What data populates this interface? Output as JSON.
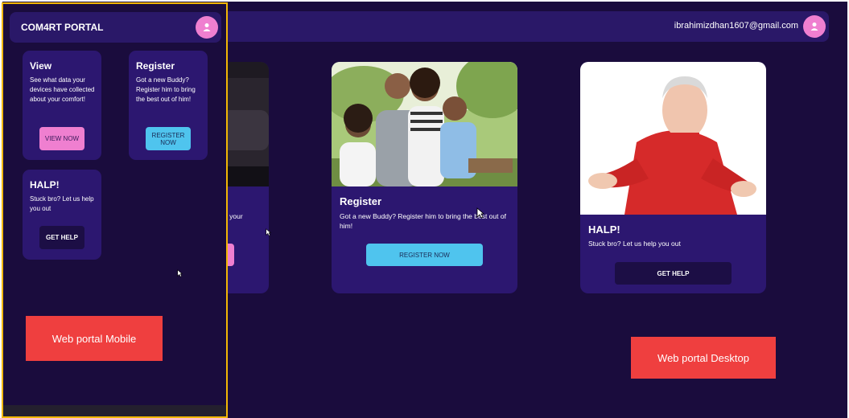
{
  "desktop": {
    "header": {
      "email": "ibrahimizdhan1607@gmail.com"
    },
    "cards": {
      "view": {
        "text": "out your",
        "button": ""
      },
      "register": {
        "title": "Register",
        "text": "Got a new Buddy? Register him to bring the best out of him!",
        "button": "REGISTER NOW"
      },
      "halp": {
        "title": "HALP!",
        "text": "Stuck bro? Let us help you out",
        "button": "GET HELP"
      }
    },
    "label": "Web portal Desktop"
  },
  "mobile": {
    "header": {
      "title": "COM4RT PORTAL"
    },
    "cards": {
      "view": {
        "title": "View",
        "text": "See what data your devices have collected about your comfort!",
        "button": "VIEW NOW"
      },
      "register": {
        "title": "Register",
        "text": "Got a new Buddy? Register him to bring the best out of him!",
        "button": "REGISTER NOW"
      },
      "halp": {
        "title": "HALP!",
        "text": "Stuck bro? Let us help you out",
        "button": "GET HELP"
      }
    },
    "label": "Web portal Mobile"
  },
  "colors": {
    "background": "#1a0c3d",
    "header": "#2a1868",
    "card": "#2c1770",
    "pink": "#ef7fd0",
    "cyan": "#4fc4ee",
    "dark_button": "#1c0e45",
    "label_red": "#ef3f3f",
    "mobile_frame": "#f2b705"
  },
  "icons": [
    "user-icon",
    "mouse-cursor-icon"
  ]
}
